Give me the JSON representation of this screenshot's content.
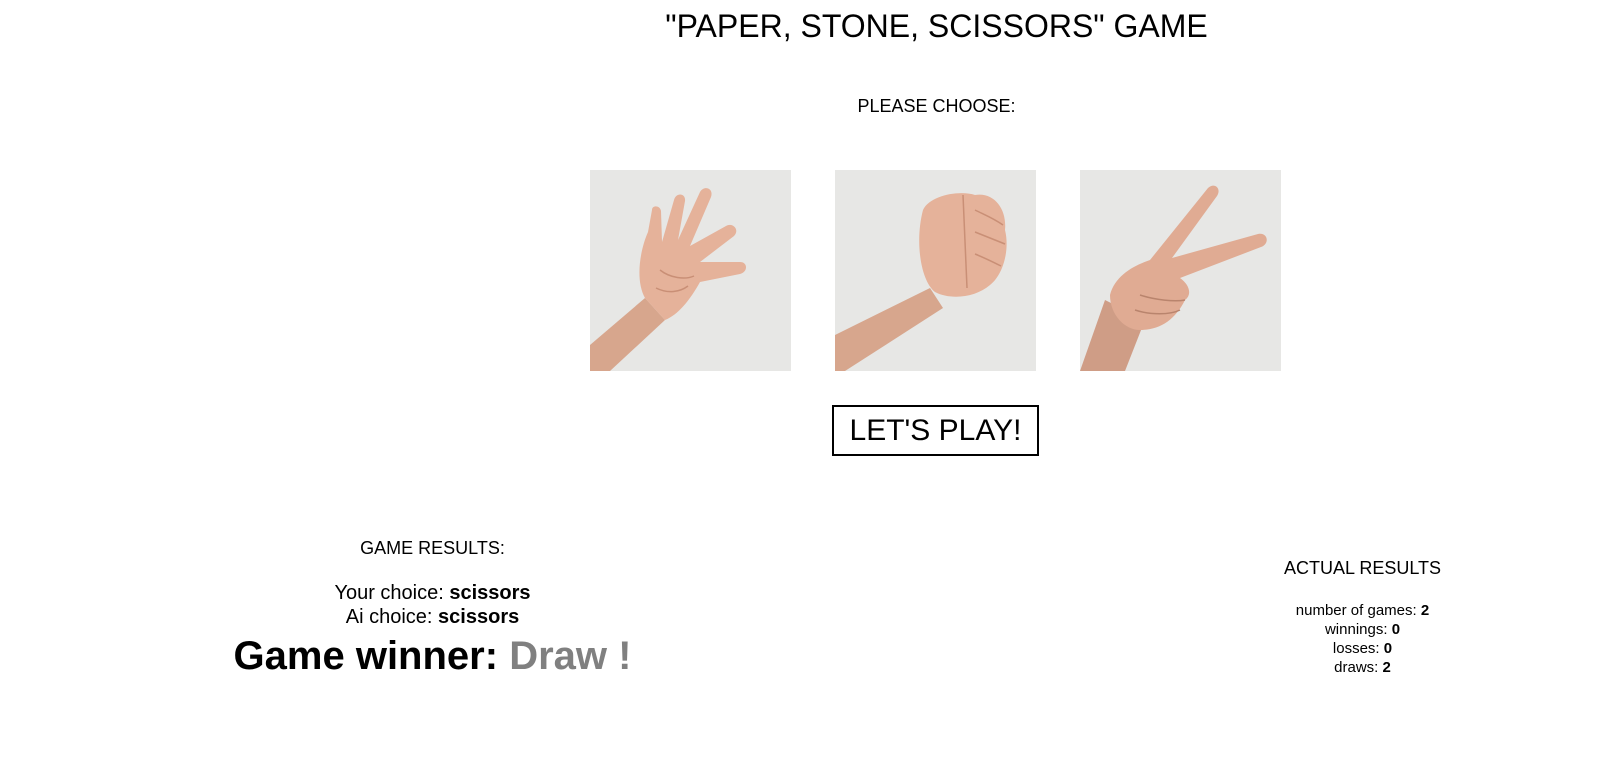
{
  "header": {
    "title": "\"PAPER, STONE, SCISSORS\" GAME",
    "choose_label": "PLEASE CHOOSE:"
  },
  "choices": [
    {
      "name": "paper",
      "icon": "open-hand-icon"
    },
    {
      "name": "stone",
      "icon": "fist-icon"
    },
    {
      "name": "scissors",
      "icon": "victory-hand-icon"
    }
  ],
  "play_button": {
    "label": "LET'S PLAY!"
  },
  "game_results": {
    "heading": "GAME RESULTS:",
    "your_choice_label": "Your choice:",
    "your_choice_value": "scissors",
    "ai_choice_label": "Ai choice:",
    "ai_choice_value": "scissors",
    "winner_label": "Game winner:",
    "winner_value": "Draw !"
  },
  "actual_results": {
    "heading": "ACTUAL RESULTS",
    "games_label": "number of games:",
    "games_value": "2",
    "wins_label": "winnings:",
    "wins_value": "0",
    "losses_label": "losses:",
    "losses_value": "0",
    "draws_label": "draws:",
    "draws_value": "2"
  },
  "colors": {
    "background": "#ffffff",
    "text": "#000000",
    "winner_value": "#808080",
    "image_background": "#e6e6e4",
    "skin": "#e9b9a3"
  }
}
